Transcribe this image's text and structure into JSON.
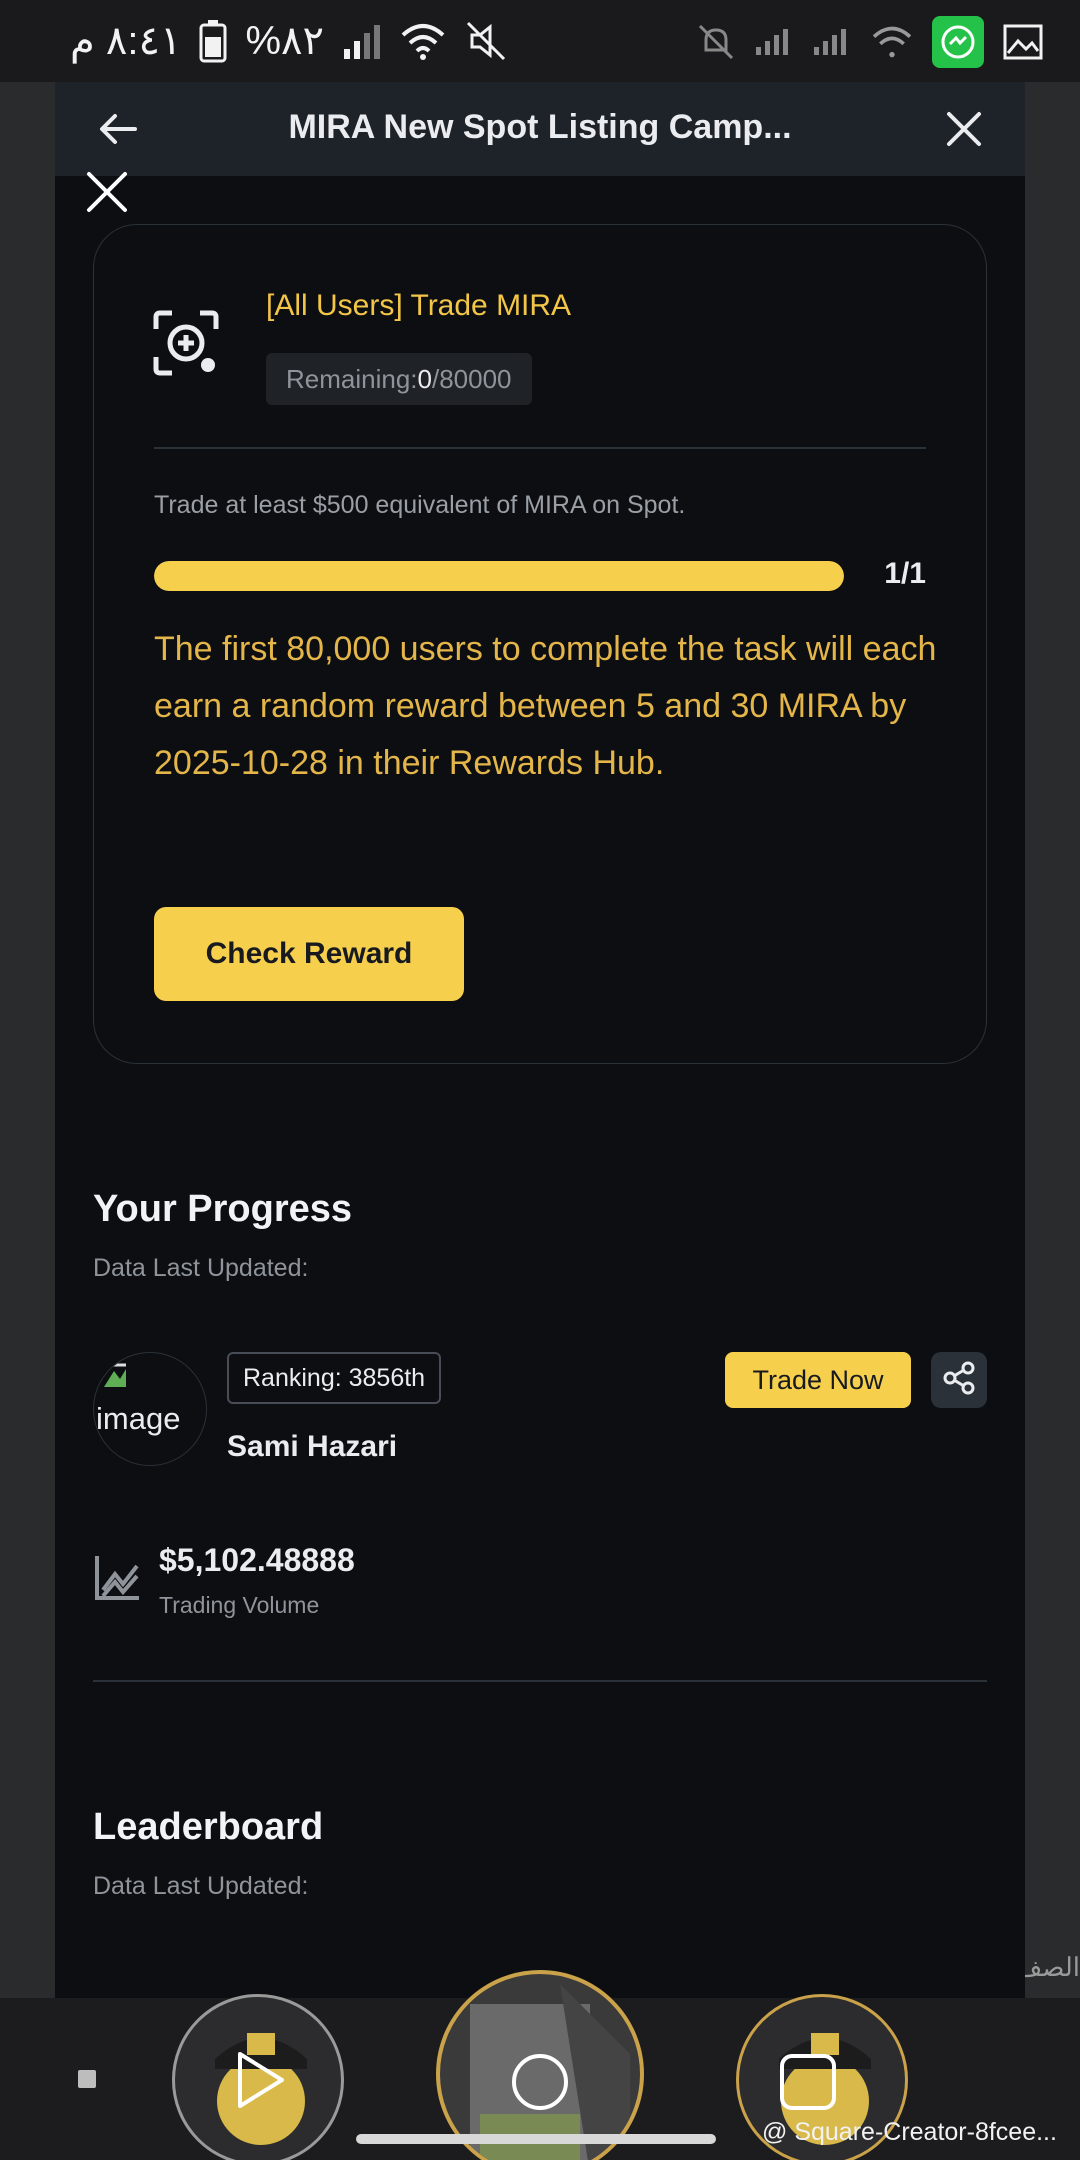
{
  "status_bar": {
    "time": "٨:٤١ م",
    "battery": "%٨٢"
  },
  "app_bar": {
    "title": "MIRA New Spot Listing Camp..."
  },
  "task": {
    "title": "[All Users] Trade MIRA",
    "remaining_label": "Remaining: ",
    "remaining_done": "0",
    "remaining_total": "/80000",
    "description": "Trade at least $500 equivalent of MIRA on Spot.",
    "progress_fraction": 1.0,
    "progress_text": "1/1",
    "reward_text": "The first 80,000 users to complete the task will each earn a random reward between 5 and 30 MIRA by 2025-10-28 in their Rewards Hub.",
    "check_button": "Check Reward"
  },
  "progress_section": {
    "title": "Your Progress",
    "updated": "Data Last Updated:",
    "avatar_alt": "image",
    "ranking": "Ranking: 3856th",
    "user_name": "Sami Hazari",
    "trade_button": "Trade Now",
    "volume_value": "$5,102.48888",
    "volume_label": "Trading Volume"
  },
  "leaderboard": {
    "title": "Leaderboard",
    "updated": "Data Last Updated:"
  },
  "side_text": "الصف",
  "watermark": "@ Square-Creator-8fcee...",
  "colors": {
    "accent": "#f6d04d",
    "reward_text": "#e4b64a",
    "background": "#0c0e12"
  }
}
